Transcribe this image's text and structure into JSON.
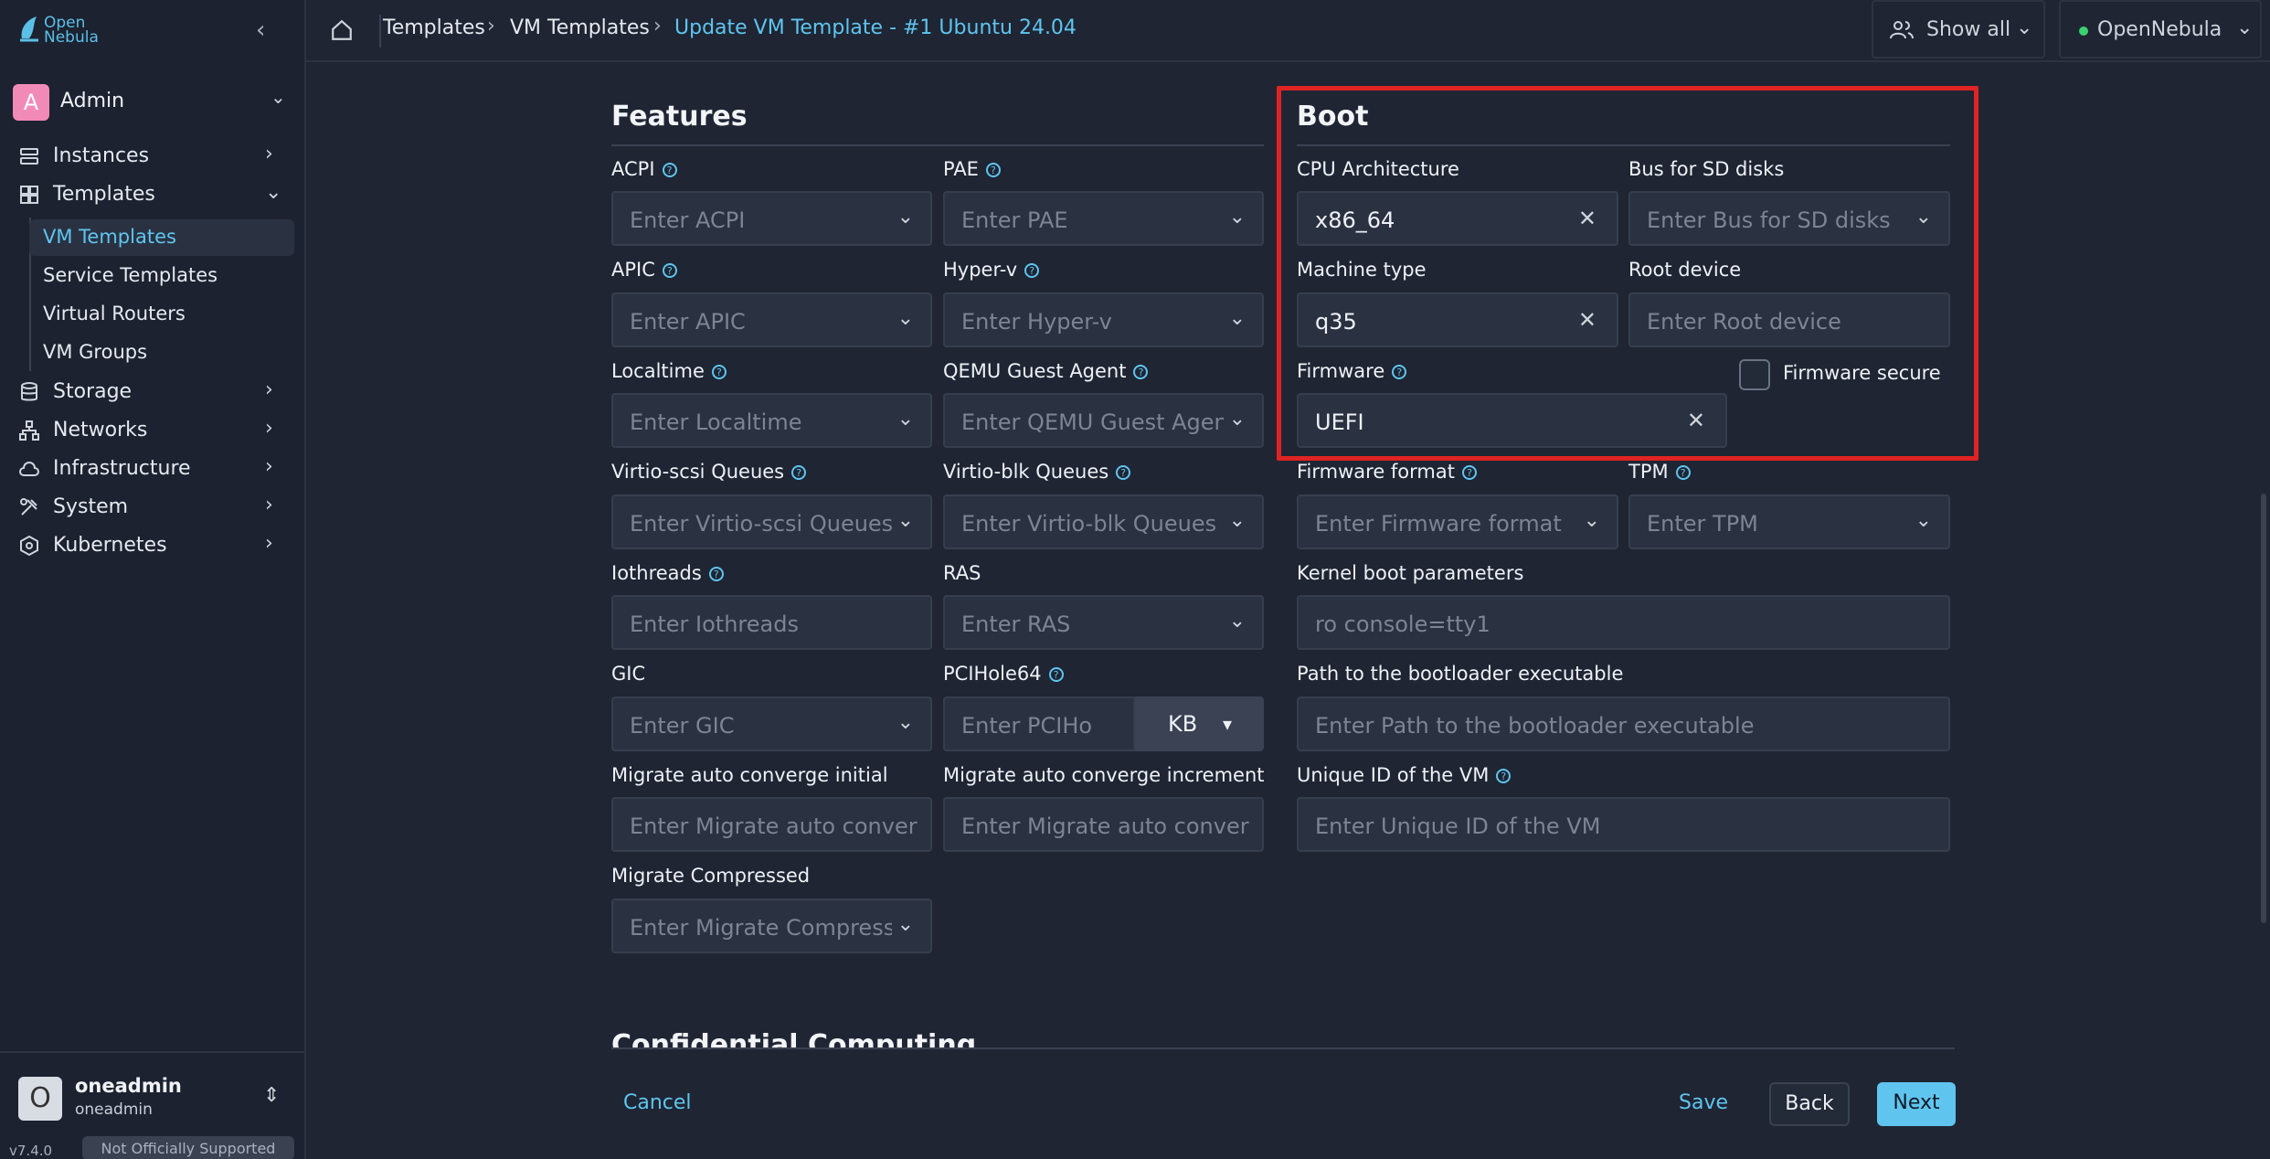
{
  "app": {
    "logo_line1": "Open",
    "logo_line2": "Nebula",
    "collapse_icon": "chevron-left-icon"
  },
  "user_menu": {
    "initial": "A",
    "name": "Admin"
  },
  "sidebar": {
    "items": [
      {
        "label": "Instances",
        "icon": "instances-icon"
      },
      {
        "label": "Templates",
        "icon": "templates-icon",
        "expanded": true
      },
      {
        "label": "Storage",
        "icon": "storage-icon"
      },
      {
        "label": "Networks",
        "icon": "networks-icon"
      },
      {
        "label": "Infrastructure",
        "icon": "cloud-icon"
      },
      {
        "label": "System",
        "icon": "system-icon"
      },
      {
        "label": "Kubernetes",
        "icon": "kubernetes-icon"
      }
    ],
    "sub_items": [
      {
        "label": "VM Templates",
        "active": true
      },
      {
        "label": "Service Templates"
      },
      {
        "label": "Virtual Routers"
      },
      {
        "label": "VM Groups"
      }
    ]
  },
  "footer": {
    "initial": "O",
    "name": "oneadmin",
    "sub": "oneadmin",
    "version": "v7.4.0",
    "badge": "Not Officially Supported"
  },
  "breadcrumb": {
    "items": [
      "Templates",
      "VM Templates"
    ],
    "current": "Update VM Template - #1 Ubuntu 24.04"
  },
  "topbar": {
    "show_all": "Show all",
    "zone": "OpenNebula",
    "zone_status_color": "#3ccf6e"
  },
  "features": {
    "title": "Features",
    "fields": {
      "acpi": {
        "label": "ACPI",
        "placeholder": "Enter ACPI"
      },
      "pae": {
        "label": "PAE",
        "placeholder": "Enter PAE"
      },
      "apic": {
        "label": "APIC",
        "placeholder": "Enter APIC"
      },
      "hyperv": {
        "label": "Hyper-v",
        "placeholder": "Enter Hyper-v"
      },
      "localtime": {
        "label": "Localtime",
        "placeholder": "Enter Localtime"
      },
      "qemu": {
        "label": "QEMU Guest Agent",
        "placeholder": "Enter QEMU Guest Agen"
      },
      "vscsi": {
        "label": "Virtio-scsi Queues",
        "placeholder": "Enter Virtio-scsi Queues"
      },
      "vblk": {
        "label": "Virtio-blk Queues",
        "placeholder": "Enter Virtio-blk Queues"
      },
      "iothreads": {
        "label": "Iothreads",
        "placeholder": "Enter Iothreads"
      },
      "ras": {
        "label": "RAS",
        "placeholder": "Enter RAS"
      },
      "gic": {
        "label": "GIC",
        "placeholder": "Enter GIC"
      },
      "pcihole": {
        "label": "PCIHole64",
        "placeholder": "Enter PCIHo",
        "unit": "KB"
      },
      "mig_init": {
        "label": "Migrate auto converge initial",
        "placeholder": "Enter Migrate auto conver"
      },
      "mig_inc": {
        "label": "Migrate auto converge increment",
        "placeholder": "Enter Migrate auto conver"
      },
      "mig_comp": {
        "label": "Migrate Compressed",
        "placeholder": "Enter Migrate Compressé"
      }
    }
  },
  "boot": {
    "title": "Boot",
    "fields": {
      "cpu_arch": {
        "label": "CPU Architecture",
        "value": "x86_64"
      },
      "bus_sd": {
        "label": "Bus for SD disks",
        "placeholder": "Enter Bus for SD disks"
      },
      "machine": {
        "label": "Machine type",
        "value": "q35"
      },
      "root_dev": {
        "label": "Root device",
        "placeholder": "Enter Root device"
      },
      "firmware": {
        "label": "Firmware",
        "value": "UEFI"
      },
      "fw_secure": {
        "label": "Firmware secure",
        "checked": false
      },
      "fw_format": {
        "label": "Firmware format",
        "placeholder": "Enter Firmware format"
      },
      "tpm": {
        "label": "TPM",
        "placeholder": "Enter TPM"
      },
      "kernel": {
        "label": "Kernel boot parameters",
        "placeholder": "ro console=tty1"
      },
      "bootloader": {
        "label": "Path to the bootloader executable",
        "placeholder": "Enter Path to the bootloader executable"
      },
      "uuid": {
        "label": "Unique ID of the VM",
        "placeholder": "Enter Unique ID of the VM"
      }
    }
  },
  "next_section": {
    "title": "Confidential Computing"
  },
  "actions": {
    "cancel": "Cancel",
    "save": "Save",
    "back": "Back",
    "next": "Next"
  },
  "colors": {
    "accent": "#5fc5ef",
    "highlight": "#e02424"
  }
}
